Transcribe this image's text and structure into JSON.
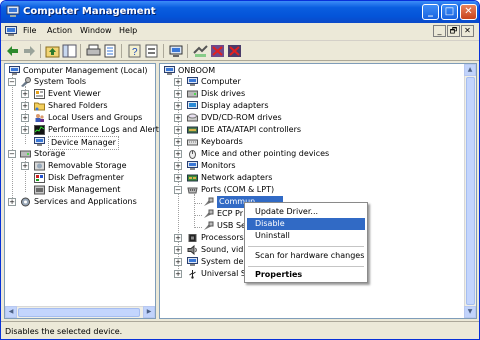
{
  "window": {
    "title": "Computer Management"
  },
  "menu": [
    "File",
    "Action",
    "Window",
    "Help"
  ],
  "mdi_buttons": [
    "_",
    "🗗",
    "✕"
  ],
  "colors": {
    "titlebar": "#0454d8",
    "selection": "#316ac5",
    "context_highlight": "#316ac5"
  },
  "left_tree": [
    {
      "label": "Computer Management (Local)",
      "icon": "computer-management-icon"
    },
    {
      "label": "System Tools",
      "icon": "tools-icon"
    },
    {
      "label": "Event Viewer",
      "icon": "event-viewer-icon"
    },
    {
      "label": "Shared Folders",
      "icon": "folder-icon"
    },
    {
      "label": "Local Users and Groups",
      "icon": "users-icon"
    },
    {
      "label": "Performance Logs and Alerts",
      "icon": "performance-icon"
    },
    {
      "label": "Device Manager",
      "icon": "device-manager-icon"
    },
    {
      "label": "Storage",
      "icon": "storage-icon"
    },
    {
      "label": "Removable Storage",
      "icon": "removable-storage-icon"
    },
    {
      "label": "Disk Defragmenter",
      "icon": "defrag-icon"
    },
    {
      "label": "Disk Management",
      "icon": "disk-management-icon"
    },
    {
      "label": "Services and Applications",
      "icon": "services-icon"
    }
  ],
  "right_tree": {
    "root": "ONBOOM",
    "items": [
      "Computer",
      "Disk drives",
      "Display adapters",
      "DVD/CD-ROM drives",
      "IDE ATA/ATAPI controllers",
      "Keyboards",
      "Mice and other pointing devices",
      "Monitors",
      "Network adapters",
      "Ports (COM & LPT)"
    ],
    "ports_children": [
      "Commun",
      "ECP Pr",
      "USB Se"
    ],
    "after": [
      "Processors",
      "Sound, vid",
      "System de",
      "Universal S"
    ]
  },
  "context_menu": {
    "items": [
      "Update Driver...",
      "Disable",
      "Uninstall",
      "Scan for hardware changes",
      "Properties"
    ],
    "highlighted": "Disable"
  },
  "status": "Disables the selected device."
}
